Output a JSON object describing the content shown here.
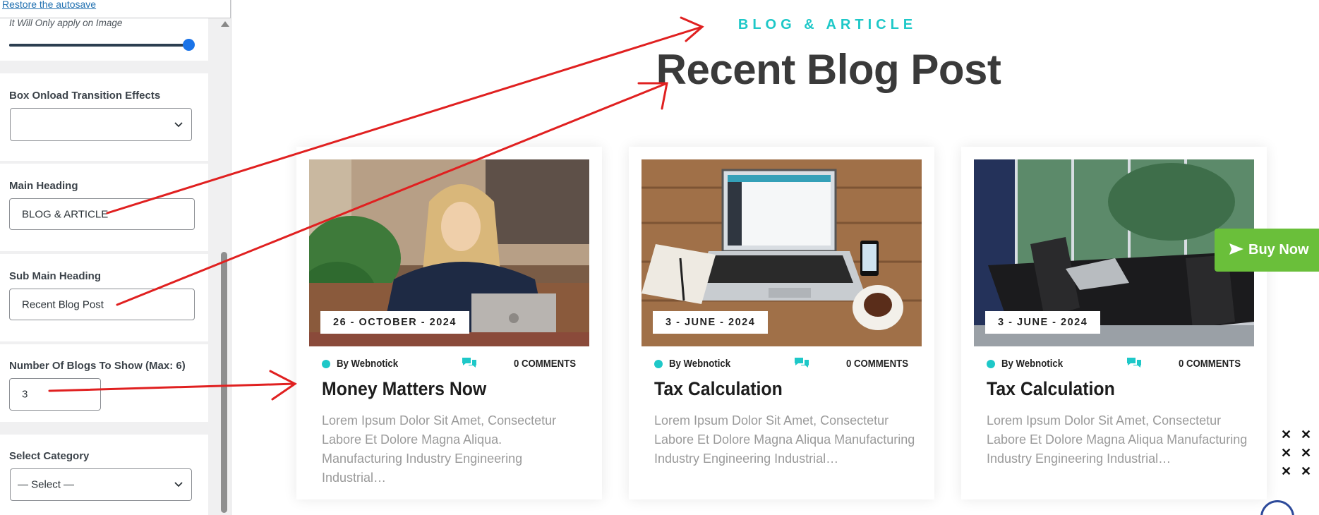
{
  "panel": {
    "restore_link": "Restore the autosave",
    "image_note": "It Will Only apply on Image",
    "slider_value_fraction": 0.98,
    "transition": {
      "label": "Box Onload Transition Effects",
      "value": ""
    },
    "main_heading": {
      "label": "Main Heading",
      "value": "BLOG & ARTICLE"
    },
    "sub_heading": {
      "label": "Sub Main Heading",
      "value": "Recent Blog Post"
    },
    "blog_count": {
      "label": "Number Of Blogs To Show (Max: 6)",
      "value": "3"
    },
    "category": {
      "label": "Select Category",
      "value": "— Select —"
    }
  },
  "preview": {
    "eyebrow": "BLOG & ARTICLE",
    "headline": "Recent Blog Post",
    "posts": [
      {
        "date": "26 - OCTOBER - 2024",
        "author": "By Webnotick",
        "comments": "0 COMMENTS",
        "title": "Money Matters Now",
        "excerpt": "Lorem Ipsum Dolor Sit Amet, Consectetur Labore Et Dolore Magna Aliqua. Manufacturing Industry Engineering Industrial…"
      },
      {
        "date": "3 - JUNE - 2024",
        "author": "By Webnotick",
        "comments": "0 COMMENTS",
        "title": "Tax Calculation",
        "excerpt": "Lorem Ipsum Dolor Sit Amet, Consectetur Labore Et Dolore Magna Aliqua Manufacturing Industry Engineering Industrial…"
      },
      {
        "date": "3 - JUNE - 2024",
        "author": "By Webnotick",
        "comments": "0 COMMENTS",
        "title": "Tax Calculation",
        "excerpt": "Lorem Ipsum Dolor Sit Amet, Consectetur Labore Et Dolore Magna Aliqua Manufacturing Industry Engineering Industrial…"
      }
    ],
    "buy_now": "Buy Now"
  },
  "colors": {
    "accent_teal": "#1ec8c8",
    "buy_green": "#6abf3a",
    "annotation_red": "#e02020",
    "slider_thumb": "#1a73e8"
  },
  "icons": [
    "chevron-down-icon",
    "comments-icon",
    "send-arrow-icon",
    "close-icon",
    "scroll-top-icon"
  ]
}
